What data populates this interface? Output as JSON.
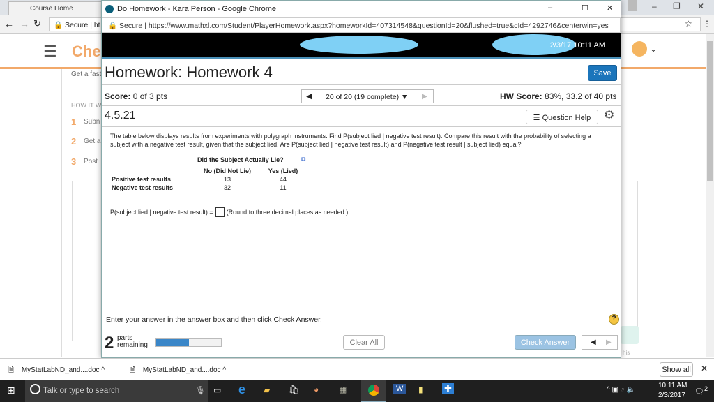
{
  "background_browser": {
    "tabs": [
      {
        "label": "Course Home"
      }
    ],
    "secure_label": "Secure",
    "address_fragment": "ht",
    "logo_text": "Che",
    "page_fragments": [
      "Get a fast",
      "HOW IT W",
      "Subn",
      "Get a",
      "Post"
    ],
    "step_numbers": [
      "1",
      "2",
      "3"
    ],
    "hint_fragment": "his"
  },
  "popup": {
    "window_title": "Do Homework - Kara Person - Google Chrome",
    "secure_label": "Secure",
    "url": "https://www.mathxl.com/Student/PlayerHomework.aspx?homeworkId=407314548&questionId=20&flushed=true&cId=4292746&centerwin=yes",
    "datetime": "2/3/17 10:11 AM",
    "homework_title": "Homework: Homework 4",
    "save_label": "Save",
    "score": {
      "label": "Score:",
      "value": "0 of 3 pts"
    },
    "question_nav": "20 of 20 (19 complete)",
    "hw_score": {
      "label": "HW Score:",
      "value": "83%, 33.2 of 40 pts"
    },
    "question_number": "4.5.21",
    "question_help_label": "Question Help",
    "question_text": "The table below displays results from experiments with polygraph instruments. Find P(subject lied | negative test result). Compare this result with the probability of selecting a subject with a negative test result, given that the subject lied. Are P(subject lied | negative test result) and P(negative test result | subject lied) equal?",
    "table": {
      "title": "Did the Subject Actually Lie?",
      "columns": [
        "No (Did Not Lie)",
        "Yes (Lied)"
      ],
      "rows": [
        {
          "label": "Positive test results",
          "values": [
            "13",
            "44"
          ]
        },
        {
          "label": "Negative test results",
          "values": [
            "32",
            "11"
          ]
        }
      ]
    },
    "answer_prompt": "P(subject lied | negative test result) =",
    "answer_value": "",
    "answer_hint": "(Round to three decimal places as needed.)",
    "instruction": "Enter your answer in the answer box and then click Check Answer.",
    "parts_remaining": {
      "count": "2",
      "label1": "parts",
      "label2": "remaining",
      "progress_percent": 50
    },
    "clear_all_label": "Clear All",
    "check_answer_label": "Check Answer"
  },
  "downloads": {
    "items": [
      {
        "label": "MyStatLabND_and....doc"
      },
      {
        "label": "MyStatLabND_and....doc"
      }
    ],
    "show_all_label": "Show all"
  },
  "taskbar": {
    "search_placeholder": "Talk or type to search",
    "time": "10:11 AM",
    "date": "2/3/2017",
    "notification_count": "2"
  },
  "colors": {
    "accent": "#1b75bb",
    "orange": "#f2a96a",
    "taskbar": "#1f1f1f"
  }
}
